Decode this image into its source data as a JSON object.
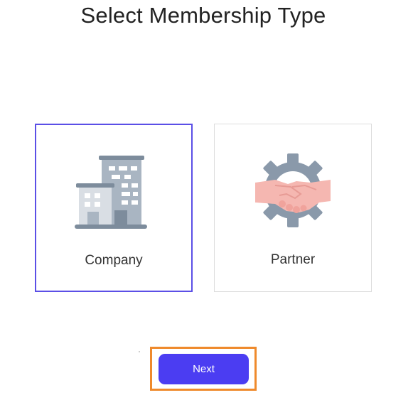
{
  "title": "Select Membership Type",
  "options": [
    {
      "label": "Company",
      "icon": "office-building-icon",
      "selected": true
    },
    {
      "label": "Partner",
      "icon": "handshake-gear-icon",
      "selected": false
    }
  ],
  "actions": {
    "next_label": "Next"
  },
  "colors": {
    "accent": "#4b3df2",
    "selected_border": "#5b4fe6",
    "focus_outline": "#ef8a2c",
    "icon_gray": "#8a99aa",
    "handshake_pink": "#f5b7b1"
  }
}
